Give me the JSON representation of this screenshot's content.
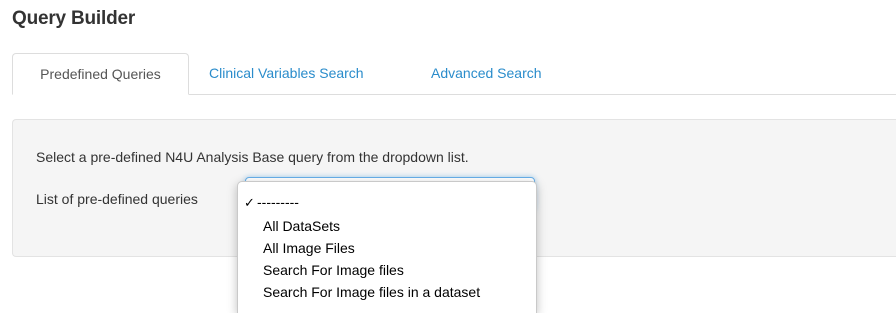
{
  "page": {
    "title": "Query Builder"
  },
  "tabs": [
    {
      "label": "Predefined Queries",
      "active": true
    },
    {
      "label": "Clinical Variables Search",
      "active": false
    },
    {
      "label": "Advanced Search",
      "active": false
    }
  ],
  "predefined": {
    "description": "Select a pre-defined N4U Analysis Base query from the dropdown list.",
    "select_label": "List of pre-defined queries",
    "select_value": "---------"
  },
  "dropdown": {
    "selected_mark": "✓",
    "options": [
      "---------",
      "All DataSets",
      "All Image Files",
      "Search For Image files",
      "Search For Image files in a dataset"
    ],
    "selected_index": 0
  },
  "colors": {
    "link": "#2a8ccb",
    "panel_bg": "#f5f5f5",
    "focus_border": "#66afe9"
  },
  "icons": {
    "check": "check-icon",
    "select_arrows": "select-arrows-icon"
  }
}
